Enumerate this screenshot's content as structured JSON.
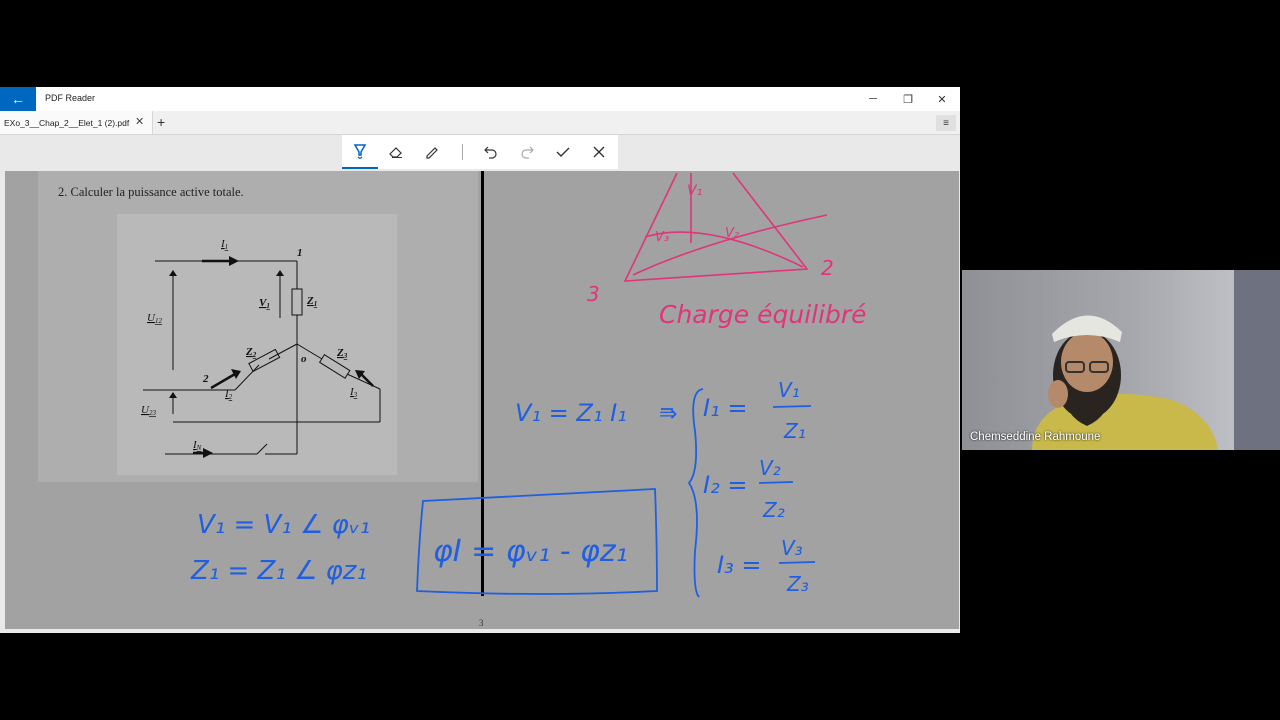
{
  "app": {
    "title": "PDF Reader",
    "back_icon": "arrow-left-icon"
  },
  "window_controls": {
    "minimize": "─",
    "restore": "❐",
    "close": "✕"
  },
  "tabs": [
    {
      "label": "EXo_3__Chap_2__Elet_1 (2).pdf",
      "close": "✕"
    }
  ],
  "tabbar": {
    "new_tab": "+",
    "menu": "≡"
  },
  "toolbar": {
    "tools": [
      "highlighter-pen-icon",
      "eraser-icon",
      "pencil-icon",
      "undo-icon",
      "redo-icon",
      "checkmark-icon",
      "close-icon"
    ],
    "active": "highlighter-pen-icon"
  },
  "document": {
    "question": "2.  Calculer la puissance active totale.",
    "page_number": "3",
    "circuit_labels": {
      "i1": "I",
      "i1_sub": "1",
      "node1": "1",
      "v1": "V",
      "v1_sub": "1",
      "z1": "Z",
      "z1_sub": "1",
      "u12": "U",
      "u12_sub": "12",
      "z2": "Z",
      "z2_sub": "2",
      "node_o": "o",
      "z3": "Z",
      "z3_sub": "3",
      "node2": "2",
      "i2": "I",
      "i2_sub": "2",
      "i3": "I",
      "i3_sub": "3",
      "u23": "U",
      "u23_sub": "23",
      "in": "I",
      "in_sub": "N"
    }
  },
  "annotations": {
    "pink": {
      "v1": "V₁",
      "v3": "V₃",
      "v2": "V₂",
      "n3": "3",
      "n2": "2",
      "text": "Charge équilibré",
      "color": "#e0357a"
    },
    "blue": {
      "eq1": "V₁ = Z₁ I₁",
      "implies": "⇒",
      "i1": "I₁ =",
      "i1_num": "V₁",
      "i1_den": "Z₁",
      "i2": "I₂ =",
      "i2_num": "V₂",
      "i2_den": "Z₂",
      "i3": "I₃ =",
      "i3_num": "V₃",
      "i3_den": "Z₃",
      "v1_polar": "V₁ = V₁ ∠ φᵥ₁",
      "z1_polar": "Z₁ = Z₁ ∠ φz₁",
      "phi": "φI = φᵥ₁ - φz₁",
      "color": "#1f5fe0"
    }
  },
  "video": {
    "participant_name": "Chemseddine Rahmoune"
  }
}
